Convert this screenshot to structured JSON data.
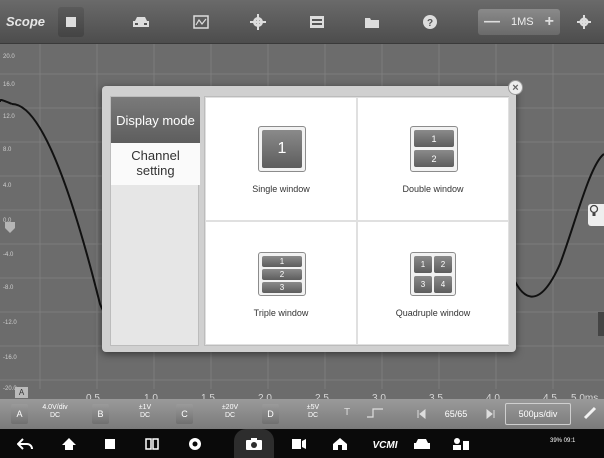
{
  "app": {
    "logo": "Scope"
  },
  "toolbar": {
    "timebase": "1MS",
    "timebase_minus": "—",
    "timebase_plus": "+"
  },
  "plot": {
    "y_labels": [
      "20.0",
      "16.0",
      "12.0",
      "8.0",
      "4.0",
      "0.0",
      "-4.0",
      "-8.0",
      "-12.0",
      "-16.0",
      "-20.0"
    ],
    "x_labels": [
      "0.5",
      "1.0",
      "1.5",
      "2.0",
      "2.5",
      "3.0",
      "3.5",
      "4.0",
      "4.5",
      "5.0ms"
    ],
    "marker_a": "A"
  },
  "modal": {
    "sidebar": {
      "display_mode": "Display mode",
      "channel_setting": "Channel setting"
    },
    "options": {
      "single": {
        "label": "Single window",
        "icon_numbers": [
          "1"
        ]
      },
      "double": {
        "label": "Double window",
        "icon_numbers": [
          "1",
          "2"
        ]
      },
      "triple": {
        "label": "Triple window",
        "icon_numbers": [
          "1",
          "2",
          "3"
        ]
      },
      "quad": {
        "label": "Quadruple window",
        "icon_numbers": [
          "1",
          "2",
          "3",
          "4"
        ]
      }
    },
    "close": "×"
  },
  "channels": [
    {
      "letter": "A",
      "scale": "4.0V/div",
      "coupling": "DC"
    },
    {
      "letter": "B",
      "scale": "±1V",
      "coupling": "DC"
    },
    {
      "letter": "C",
      "scale": "±20V",
      "coupling": "DC"
    },
    {
      "letter": "D",
      "scale": "±5V",
      "coupling": "DC"
    }
  ],
  "controls": {
    "trigger": "T",
    "page": "65/65",
    "rate": "500μs/div"
  },
  "status": {
    "text": "39% 09:1"
  }
}
